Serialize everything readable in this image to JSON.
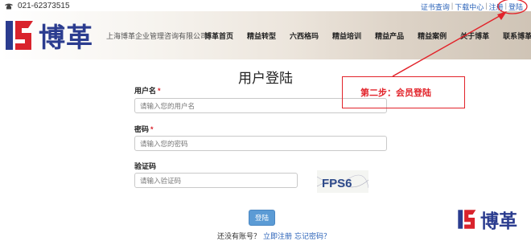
{
  "topbar": {
    "phone": "021-62373515",
    "links": [
      "证书查询",
      "下载中心",
      "注册",
      "登陆"
    ],
    "separator": "|"
  },
  "header": {
    "logo_text": "博革",
    "company": "上海博革企业管理咨询有限公司",
    "nav": [
      "博革首页",
      "精益转型",
      "六西格玛",
      "精益培训",
      "精益产品",
      "精益案例",
      "关于博革",
      "联系博革"
    ]
  },
  "form": {
    "title": "用户登陆",
    "username": {
      "label": "用户名",
      "required": "*",
      "placeholder": "请输入您的用户名"
    },
    "password": {
      "label": "密码",
      "required": "*",
      "placeholder": "请输入您的密码"
    },
    "captcha": {
      "label": "验证码",
      "placeholder": "请输入验证码",
      "image_text": "FPS6"
    },
    "login_button": "登陆",
    "no_account": "还没有账号？",
    "register_link": "立即注册",
    "forgot_link": "忘记密码？"
  },
  "annotation": {
    "text": "第二步：会员登陆",
    "color": "#e2232a"
  },
  "watermark": {
    "text": "博革"
  },
  "colors": {
    "brand_blue": "#2b3c8f",
    "brand_red": "#d9232c",
    "link": "#2a62b8",
    "button": "#5b9bd5"
  }
}
